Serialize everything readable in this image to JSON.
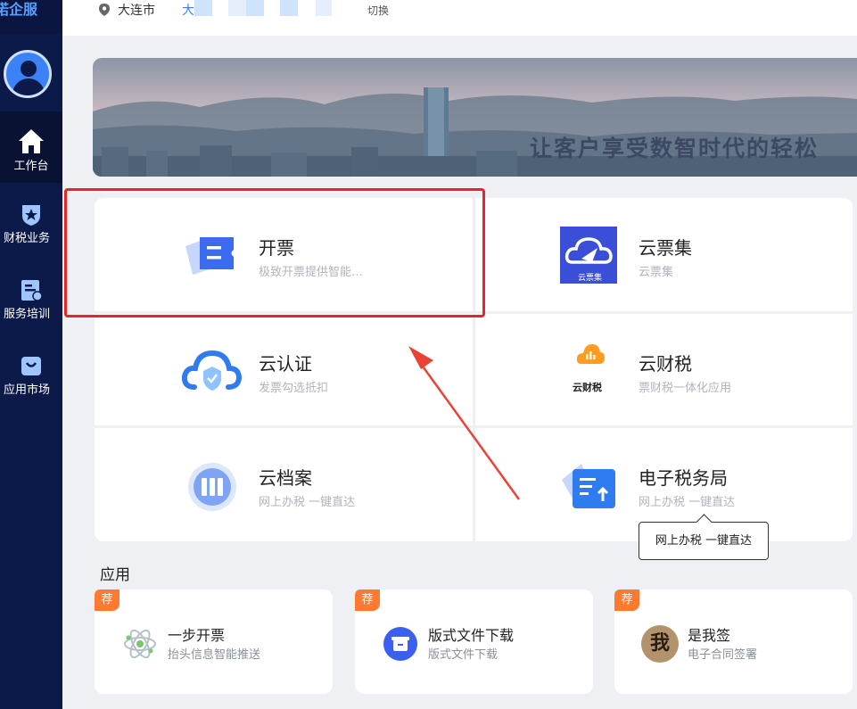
{
  "brand": "诺企服",
  "sidebar": {
    "items": [
      {
        "label": "工作台",
        "icon": "home-icon"
      },
      {
        "label": "财税业务",
        "icon": "shield-star-icon"
      },
      {
        "label": "服务培训",
        "icon": "training-icon"
      },
      {
        "label": "应用市场",
        "icon": "market-bag-icon"
      }
    ]
  },
  "topbar": {
    "city": "大连市",
    "company": "大",
    "switch_label": "切换"
  },
  "banner": {
    "slogan": "让客户享受数智时代的轻松"
  },
  "services": [
    {
      "title": "开票",
      "subtitle": "极致开票提供智能…",
      "icon": "invoice-ticket-icon"
    },
    {
      "title": "云票集",
      "subtitle": "云票集",
      "icon": "cloud-ticket-icon",
      "icon_caption": "云票集"
    },
    {
      "title": "云认证",
      "subtitle": "发票勾选抵扣",
      "icon": "cloud-shield-icon"
    },
    {
      "title": "云财税",
      "subtitle": "票财税一体化应用",
      "icon": "cloud-finance-icon",
      "icon_caption": "云财税"
    },
    {
      "title": "云档案",
      "subtitle": "网上办税 一键直达",
      "icon": "archive-icon"
    },
    {
      "title": "电子税务局",
      "subtitle": "网上办税 一键直达",
      "icon": "tax-bureau-icon"
    }
  ],
  "tooltip": "网上办税 一键直达",
  "apps": {
    "title": "应用",
    "badge": "荐",
    "items": [
      {
        "name": "一步开票",
        "sub": "抬头信息智能推送",
        "icon": "atom-icon"
      },
      {
        "name": "版式文件下载",
        "sub": "版式文件下载",
        "icon": "download-box-icon"
      },
      {
        "name": "是我签",
        "sub": "电子合同签署",
        "icon": "signature-seal-icon",
        "seal_text": "我"
      }
    ]
  },
  "colors": {
    "sidebar": "#0c1a4a",
    "accent": "#3b82f6",
    "highlight": "#e8242b",
    "badge": "#ff7a2f"
  }
}
